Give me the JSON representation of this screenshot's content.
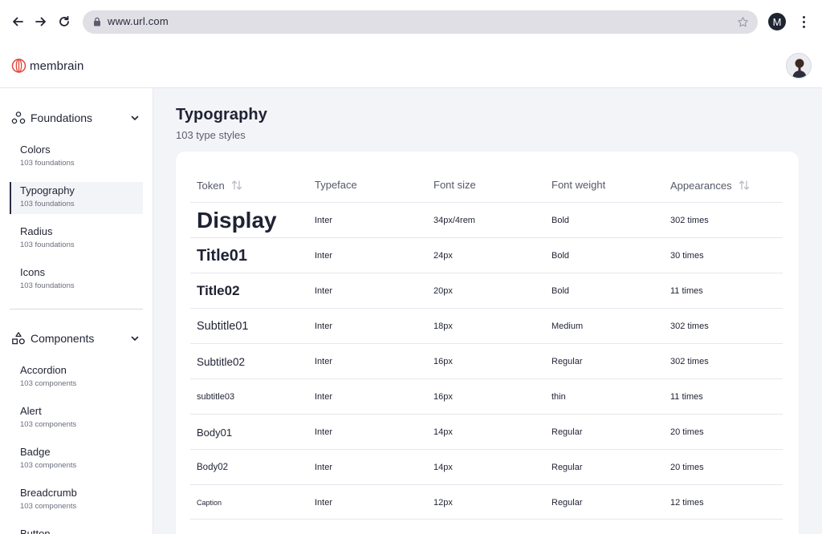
{
  "browser": {
    "url": "www.url.com",
    "profile_initial": "M"
  },
  "app": {
    "logo_text": "membrain"
  },
  "sidebar": {
    "sections": [
      {
        "label": "Foundations",
        "items": [
          {
            "label": "Colors",
            "sub": "103 foundations"
          },
          {
            "label": "Typography",
            "sub": "103 foundations"
          },
          {
            "label": "Radius",
            "sub": "103 foundations"
          },
          {
            "label": "Icons",
            "sub": "103 foundations"
          }
        ]
      },
      {
        "label": "Components",
        "items": [
          {
            "label": "Accordion",
            "sub": "103 components"
          },
          {
            "label": "Alert",
            "sub": "103 components"
          },
          {
            "label": "Badge",
            "sub": "103 components"
          },
          {
            "label": "Breadcrumb",
            "sub": "103 components"
          },
          {
            "label": "Button",
            "sub": ""
          }
        ]
      }
    ],
    "active_item": "Typography"
  },
  "main": {
    "title": "Typography",
    "subtitle": "103 type styles",
    "table": {
      "headers": {
        "token": "Token",
        "typeface": "Typeface",
        "font_size": "Font size",
        "font_weight": "Font weight",
        "appearances": "Appearances"
      },
      "rows": [
        {
          "token": "Display",
          "typeface": "Inter",
          "size": "34px/4rem",
          "weight": "Bold",
          "appearances": "302 times"
        },
        {
          "token": "Title01",
          "typeface": "Inter",
          "size": "24px",
          "weight": "Bold",
          "appearances": "30 times"
        },
        {
          "token": "Title02",
          "typeface": "Inter",
          "size": "20px",
          "weight": "Bold",
          "appearances": "11 times"
        },
        {
          "token": "Subtitle01",
          "typeface": "Inter",
          "size": "18px",
          "weight": "Medium",
          "appearances": "302 times"
        },
        {
          "token": "Subtitle02",
          "typeface": "Inter",
          "size": "16px",
          "weight": "Regular",
          "appearances": "302 times"
        },
        {
          "token": "subtitle03",
          "typeface": "Inter",
          "size": "16px",
          "weight": "thin",
          "appearances": "11 times"
        },
        {
          "token": "Body01",
          "typeface": "Inter",
          "size": "14px",
          "weight": "Regular",
          "appearances": "20 times"
        },
        {
          "token": "Body02",
          "typeface": "Inter",
          "size": "14px",
          "weight": "Regular",
          "appearances": "20 times"
        },
        {
          "token": "Caption",
          "typeface": "Inter",
          "size": "12px",
          "weight": "Regular",
          "appearances": "12 times"
        }
      ]
    }
  },
  "colors": {
    "accent_dark": "#2a2c46",
    "logo_red": "#e0453a",
    "sidebar_active_bg": "#f3f4f8"
  }
}
